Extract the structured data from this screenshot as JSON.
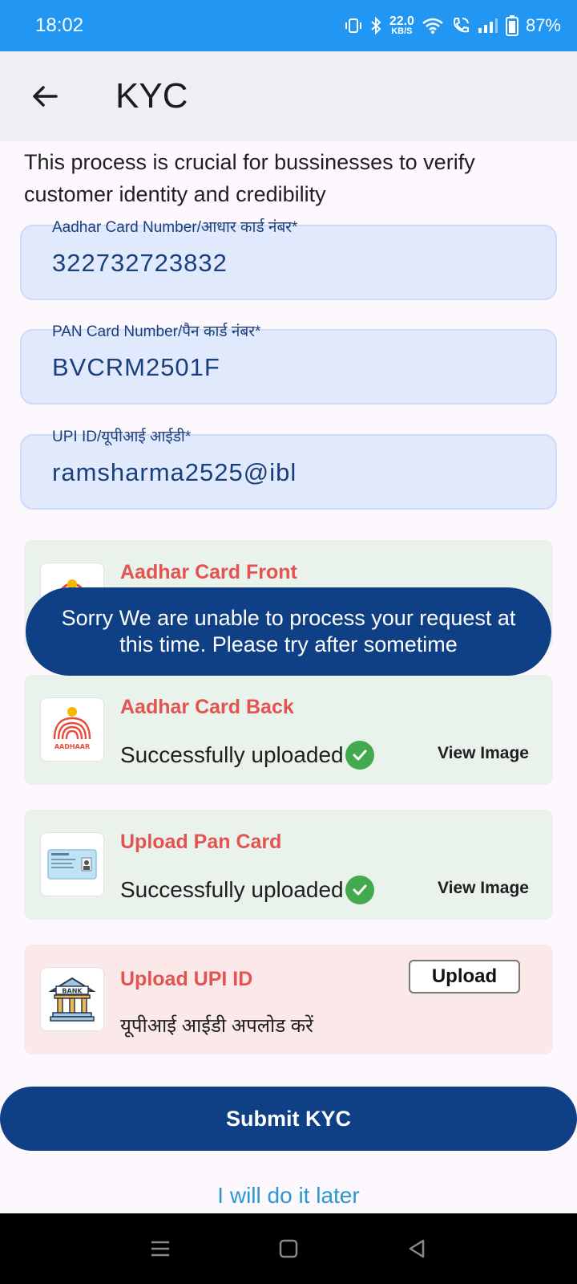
{
  "status_bar": {
    "time": "18:02",
    "net_speed_top": "22.0",
    "net_speed_bottom": "KB/S",
    "battery": "87%"
  },
  "app_bar": {
    "title": "KYC",
    "back_icon": "arrow-left-icon"
  },
  "intro_text": "This process is crucial for bussinesses to verify customer identity and credibility",
  "fields": [
    {
      "label": "Aadhar Card Number/आधार कार्ड नंबर*",
      "value": "322732723832"
    },
    {
      "label": "PAN Card Number/पैन कार्ड नंबर*",
      "value": "BVCRM2501F"
    },
    {
      "label": "UPI ID/यूपीआई आईडी*",
      "value": "ramsharma2525@ibl"
    }
  ],
  "documents": [
    {
      "title": "Aadhar Card Front",
      "icon": "aadhaar-logo-icon"
    },
    {
      "title": "Aadhar Card Back",
      "status": "Successfully uploaded",
      "action": "View Image",
      "icon": "aadhaar-logo-icon",
      "logo_text": "AADHAAR"
    },
    {
      "title": "Upload Pan Card",
      "status": "Successfully uploaded",
      "action": "View Image",
      "icon": "pan-card-icon"
    },
    {
      "title": "Upload UPI ID",
      "hint": "यूपीआई आईडी अपलोड करें",
      "action": "Upload",
      "icon": "bank-icon",
      "logo_text": "BANK"
    }
  ],
  "toast": "Sorry We are unable to process your request at this time. Please try after sometime",
  "submit_label": "Submit KYC",
  "later_label": "I will do it later",
  "colors": {
    "status_bar": "#2196f3",
    "primary": "#0f3f85",
    "doc_title": "#e35350",
    "success": "#43a94f",
    "link": "#2a97d1"
  }
}
